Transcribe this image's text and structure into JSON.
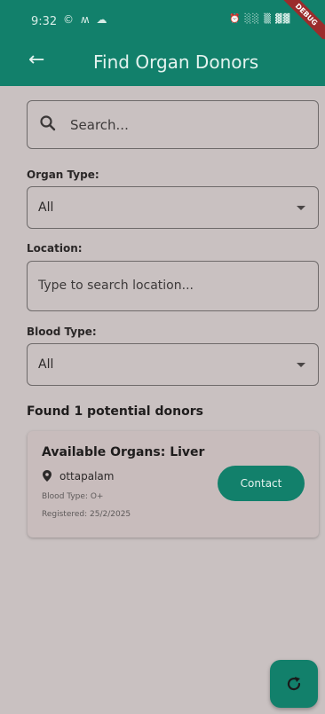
{
  "status_bar": {
    "time": "9:32",
    "left_icons": "© ʍ ☁",
    "right_icons": "⏰ ░░ ▒ ▓▓"
  },
  "debug_banner": "DEBUG",
  "app_bar": {
    "back_icon": "←",
    "title": "Find Organ Donors"
  },
  "search": {
    "placeholder": "Search..."
  },
  "organ_type": {
    "label": "Organ Type:",
    "selected": "All"
  },
  "location": {
    "label": "Location:",
    "placeholder": "Type to search location..."
  },
  "blood_type": {
    "label": "Blood Type:",
    "selected": "All"
  },
  "results": {
    "heading": "Found 1 potential donors",
    "donors": [
      {
        "title": "Available Organs: Liver",
        "location": "ottapalam",
        "blood_type": "Blood Type: O+",
        "registered": "Registered: 25/2/2025",
        "contact_label": "Contact"
      }
    ]
  },
  "colors": {
    "primary": "#12806b",
    "background": "#c9c1c1",
    "card": "#c8bcbc"
  },
  "icons": {
    "back": "arrow-left-icon",
    "search": "search-icon",
    "dropdown": "caret-down-icon",
    "location": "location-pin-icon",
    "refresh": "refresh-icon"
  }
}
